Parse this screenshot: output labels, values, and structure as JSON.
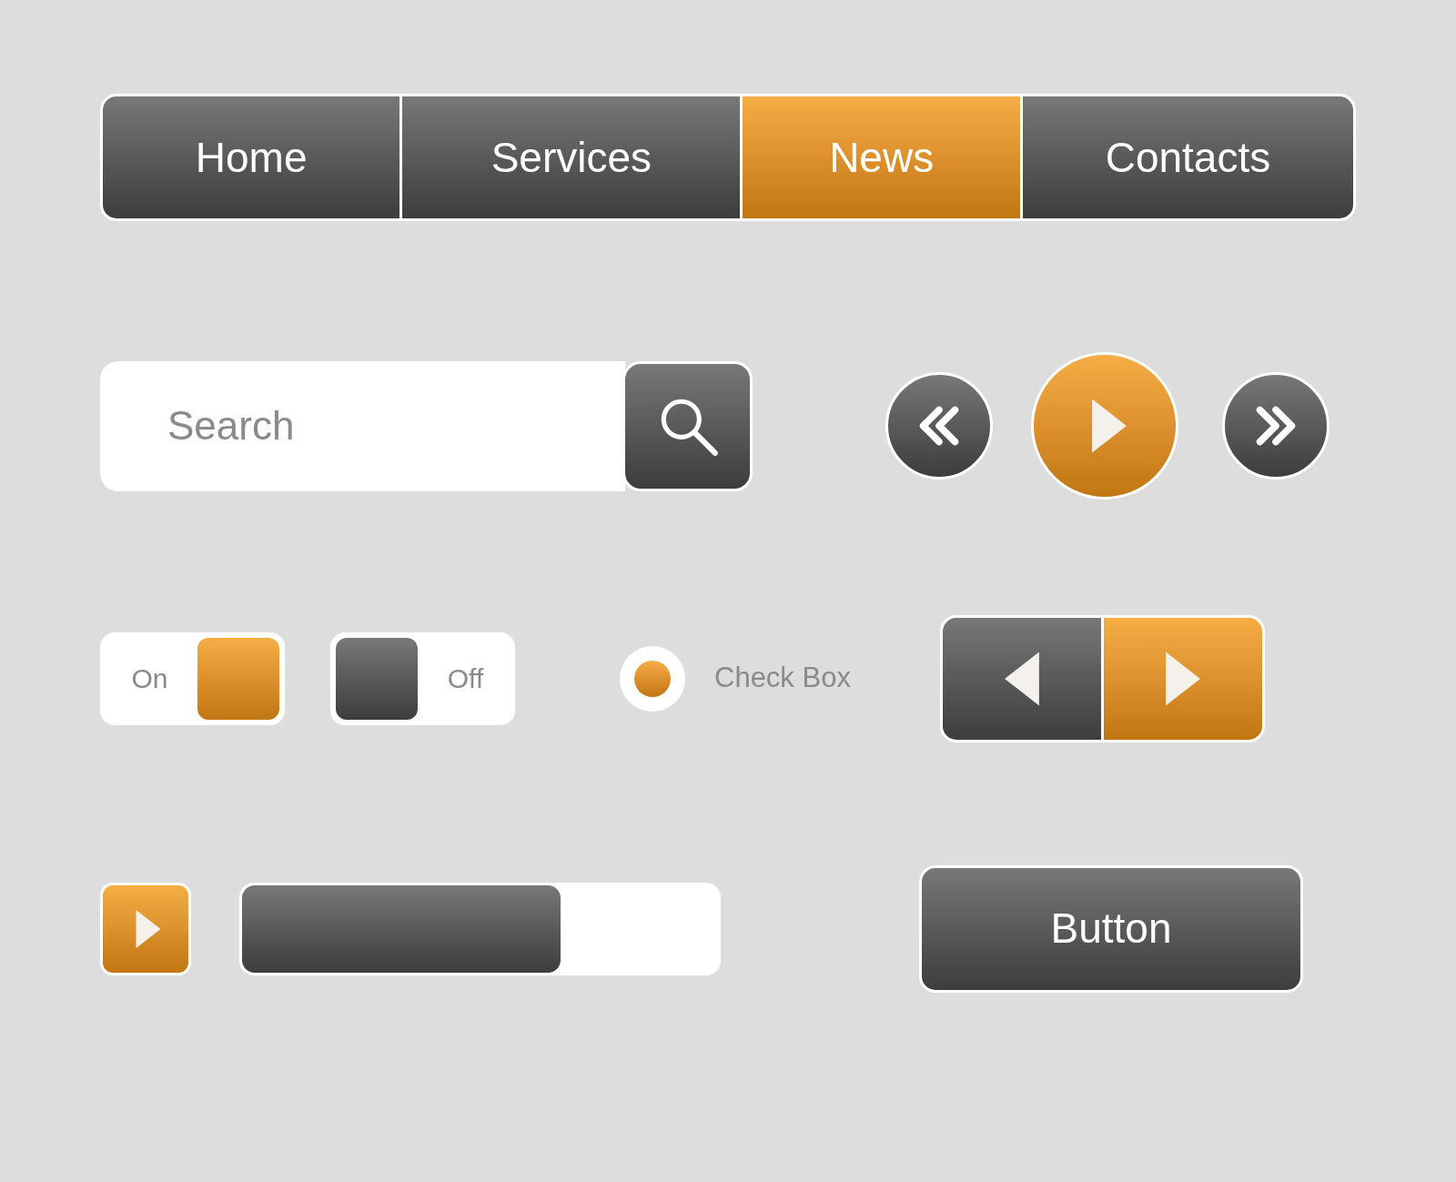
{
  "nav_tabs": [
    {
      "label": "Home",
      "selected": false
    },
    {
      "label": "Services",
      "selected": false
    },
    {
      "label": "News",
      "selected": true
    },
    {
      "label": "Contacts",
      "selected": false
    }
  ],
  "search": {
    "placeholder": "Search"
  },
  "toggles": [
    {
      "label": "On",
      "on": true
    },
    {
      "label": "Off",
      "on": false
    }
  ],
  "radio": {
    "label": "Check Box",
    "checked": true
  },
  "arrow_buttons": [
    {
      "selected": false
    },
    {
      "selected": true
    }
  ],
  "progress": {
    "level": 0.67
  },
  "button": {
    "label": "Button"
  }
}
